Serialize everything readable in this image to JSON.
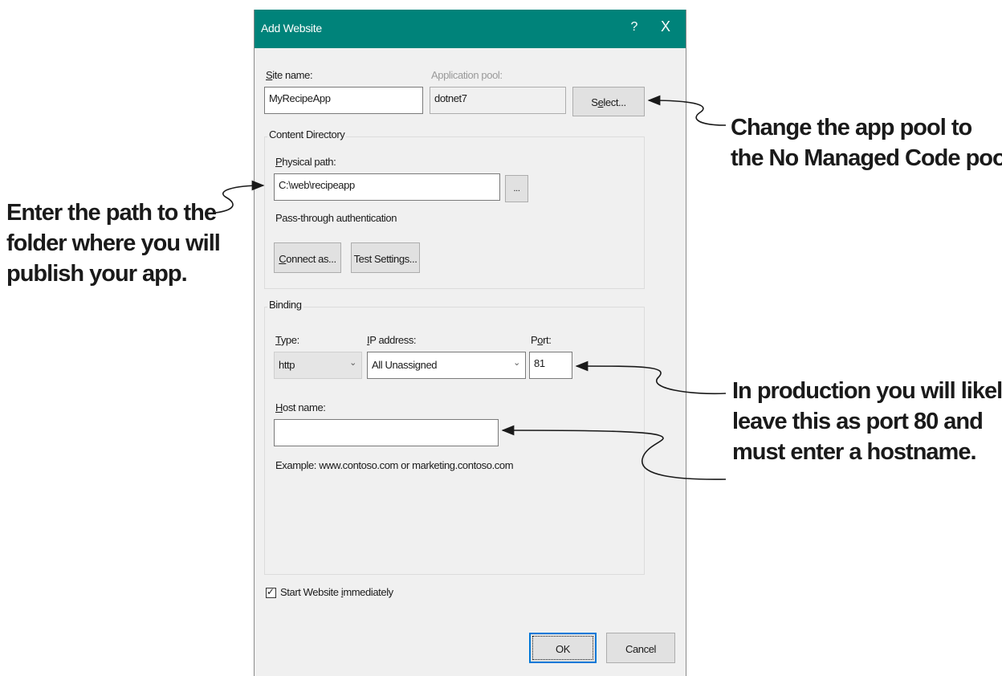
{
  "window": {
    "title": "Add Website",
    "help_label": "?",
    "close_label": "X"
  },
  "site": {
    "site_name_label": "Site name:",
    "site_name_accel": "S",
    "site_name_rest": "ite name:",
    "site_name_value": "MyRecipeApp",
    "app_pool_label": "Application pool:",
    "app_pool_value": "dotnet7",
    "select_label_a": "S",
    "select_label_accel": "e",
    "select_label_b": "lect..."
  },
  "content_directory": {
    "group_title": "Content Directory",
    "physical_path_accel": "P",
    "physical_path_rest": "hysical path:",
    "physical_path_value": "C:\\web\\recipeapp",
    "browse_label": "...",
    "pass_through": "Pass-through authentication",
    "connect_as_accel": "C",
    "connect_as_rest": "onnect as...",
    "test_settings_label": "Test Settings..."
  },
  "binding": {
    "group_title": "Binding",
    "type_accel": "T",
    "type_rest": "ype:",
    "type_value": "http",
    "ip_accel": "I",
    "ip_rest": "P address:",
    "ip_value": "All Unassigned",
    "port_a": "P",
    "port_accel": "o",
    "port_b": "rt:",
    "port_value": "81",
    "host_accel": "H",
    "host_rest": "ost name:",
    "host_value": "",
    "example": "Example: www.contoso.com or marketing.contoso.com"
  },
  "start_immediately": {
    "label_a": "Start Website ",
    "label_accel": "i",
    "label_b": "mmediately",
    "checked": true
  },
  "footer": {
    "ok_label": "OK",
    "cancel_label": "Cancel"
  },
  "annotations": {
    "app_pool_note": [
      "Change the app pool to",
      "the No Managed Code pool."
    ],
    "path_note": [
      "Enter the path to the",
      "folder where you will",
      "publish your app."
    ],
    "port_note": [
      "In production you will likely",
      "leave this as port 80 and",
      "must enter a hostname."
    ]
  },
  "colors": {
    "titlebar": "#00837a",
    "dialog_bg": "#f0f0f0",
    "default_button_border": "#0078d7"
  },
  "icons": {
    "check": "checkmark-icon",
    "chevron": "chevron-down-icon"
  }
}
